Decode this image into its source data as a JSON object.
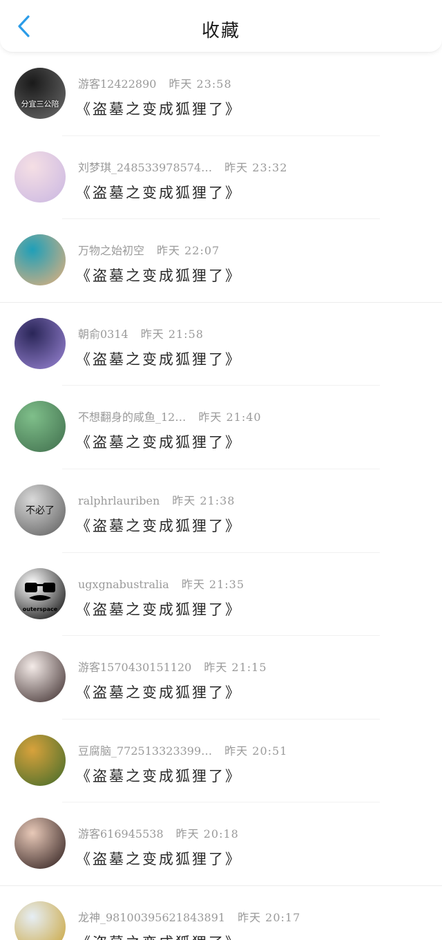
{
  "header": {
    "title": "收藏",
    "back_icon": "chevron-left-icon",
    "accent": "#2b9ce8"
  },
  "items": [
    {
      "user": "游客12422890",
      "time": "昨天 23:58",
      "book": "《盗墓之变成狐狸了》",
      "avatar_text": "分宜三公陪",
      "avatar_colors": [
        "#1a1a1a",
        "#6c6c6c"
      ]
    },
    {
      "user": "刘梦琪_248533978574…",
      "time": "昨天 23:32",
      "book": "《盗墓之变成狐狸了》",
      "avatar_text": "",
      "avatar_colors": [
        "#f5dfe4",
        "#c9b6e2"
      ]
    },
    {
      "user": "万物之始初空",
      "time": "昨天 22:07",
      "book": "《盗墓之变成狐狸了》",
      "avatar_text": "",
      "avatar_colors": [
        "#1f9fb8",
        "#e8b07a"
      ]
    },
    {
      "user": "朝俞0314",
      "time": "昨天 21:58",
      "book": "《盗墓之变成狐狸了》",
      "avatar_text": "",
      "avatar_colors": [
        "#2a2658",
        "#9b86d6"
      ]
    },
    {
      "user": "不想翻身的咸鱼_12…",
      "time": "昨天 21:40",
      "book": "《盗墓之变成狐狸了》",
      "avatar_text": "",
      "avatar_colors": [
        "#7fbf8a",
        "#3f6d4c"
      ]
    },
    {
      "user": "ralphrlauriben",
      "time": "昨天 21:38",
      "book": "《盗墓之变成狐狸了》",
      "avatar_text": "不必了",
      "avatar_colors": [
        "#d9d9d9",
        "#5a5a5a"
      ]
    },
    {
      "user": "ugxgnabustralia",
      "time": "昨天 21:35",
      "book": "《盗墓之变成狐狸了》",
      "avatar_text": "outerspace",
      "avatar_colors": [
        "#ffffff",
        "#000000"
      ]
    },
    {
      "user": "游客1570430151120",
      "time": "昨天 21:15",
      "book": "《盗墓之变成狐狸了》",
      "avatar_text": "",
      "avatar_colors": [
        "#f4ebe8",
        "#3a2a2a"
      ]
    },
    {
      "user": "豆腐脑_772513323399…",
      "time": "昨天 20:51",
      "book": "《盗墓之变成狐狸了》",
      "avatar_text": "",
      "avatar_colors": [
        "#d8a23c",
        "#3f6a2a"
      ]
    },
    {
      "user": "游客616945538",
      "time": "昨天 20:18",
      "book": "《盗墓之变成狐狸了》",
      "avatar_text": "",
      "avatar_colors": [
        "#e8c9b8",
        "#2a1a1a"
      ]
    },
    {
      "user": "龙神_98100395621843891",
      "time": "昨天 20:17",
      "book": "《盗墓之变成狐狸了》",
      "avatar_text": "",
      "avatar_colors": [
        "#e6eef5",
        "#c8a030"
      ]
    }
  ]
}
